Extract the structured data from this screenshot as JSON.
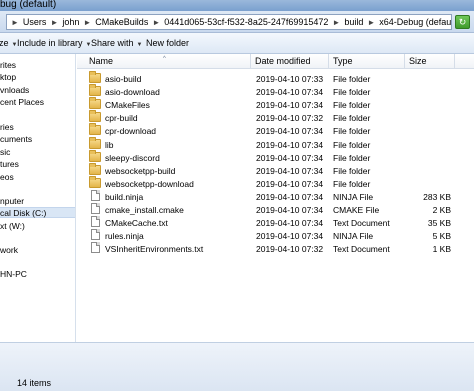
{
  "window": {
    "title": "bug (default)"
  },
  "address": {
    "crumbs": [
      "Users",
      "john",
      "CMakeBuilds",
      "0441d065-53cf-f532-8a25-247f69915472",
      "build",
      "x64-Debug (default)"
    ],
    "refresh_icon": "refresh-icon"
  },
  "toolbar": {
    "organize_label": "ize",
    "include_label": "Include in library",
    "share_label": "Share with",
    "newfolder_label": "New folder"
  },
  "nav": {
    "items": [
      "rites",
      "ktop",
      "vnloads",
      "cent Places",
      "ries",
      "cuments",
      "sic",
      "tures",
      "eos",
      "nputer",
      "cal Disk (C:)",
      "xt (W:)",
      "work",
      "HN-PC"
    ]
  },
  "columns": {
    "name": "Name",
    "date": "Date modified",
    "type": "Type",
    "size": "Size"
  },
  "files": [
    {
      "name": "asio-build",
      "date": "2019-04-10 07:33",
      "type": "File folder",
      "size": "",
      "kind": "folder"
    },
    {
      "name": "asio-download",
      "date": "2019-04-10 07:34",
      "type": "File folder",
      "size": "",
      "kind": "folder"
    },
    {
      "name": "CMakeFiles",
      "date": "2019-04-10 07:34",
      "type": "File folder",
      "size": "",
      "kind": "folder"
    },
    {
      "name": "cpr-build",
      "date": "2019-04-10 07:32",
      "type": "File folder",
      "size": "",
      "kind": "folder"
    },
    {
      "name": "cpr-download",
      "date": "2019-04-10 07:34",
      "type": "File folder",
      "size": "",
      "kind": "folder"
    },
    {
      "name": "lib",
      "date": "2019-04-10 07:34",
      "type": "File folder",
      "size": "",
      "kind": "folder"
    },
    {
      "name": "sleepy-discord",
      "date": "2019-04-10 07:34",
      "type": "File folder",
      "size": "",
      "kind": "folder"
    },
    {
      "name": "websocketpp-build",
      "date": "2019-04-10 07:34",
      "type": "File folder",
      "size": "",
      "kind": "folder"
    },
    {
      "name": "websocketpp-download",
      "date": "2019-04-10 07:34",
      "type": "File folder",
      "size": "",
      "kind": "folder"
    },
    {
      "name": "build.ninja",
      "date": "2019-04-10 07:34",
      "type": "NINJA File",
      "size": "283 KB",
      "kind": "file"
    },
    {
      "name": "cmake_install.cmake",
      "date": "2019-04-10 07:34",
      "type": "CMAKE File",
      "size": "2 KB",
      "kind": "file"
    },
    {
      "name": "CMakeCache.txt",
      "date": "2019-04-10 07:34",
      "type": "Text Document",
      "size": "35 KB",
      "kind": "file"
    },
    {
      "name": "rules.ninja",
      "date": "2019-04-10 07:34",
      "type": "NINJA File",
      "size": "5 KB",
      "kind": "file"
    },
    {
      "name": "VSInheritEnvironments.txt",
      "date": "2019-04-10 07:32",
      "type": "Text Document",
      "size": "1 KB",
      "kind": "file"
    }
  ],
  "status": {
    "count": "14 items"
  }
}
